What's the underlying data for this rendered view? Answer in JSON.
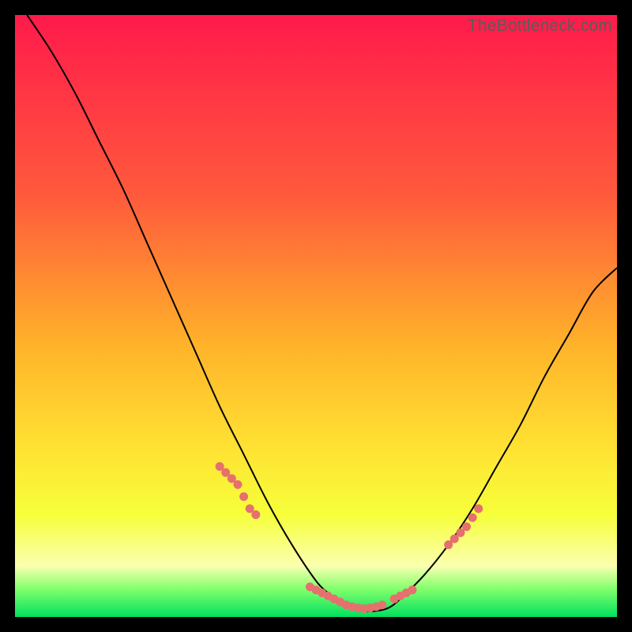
{
  "watermark": "TheBottleneck.com",
  "colors": {
    "grad_top": "#ff1a4b",
    "grad_mid1": "#ff5a3c",
    "grad_mid2": "#ffb329",
    "grad_mid3": "#ffe233",
    "grad_yellowish": "#f6ff3a",
    "grad_pale": "#fbffb0",
    "grad_green1": "#7dff6a",
    "grad_green2": "#00e060",
    "curve": "#000000",
    "dots": "#e6706e"
  },
  "chart_data": {
    "type": "line",
    "title": "",
    "xlabel": "",
    "ylabel": "",
    "xlim": [
      0,
      100
    ],
    "ylim": [
      0,
      100
    ],
    "series": [
      {
        "name": "curve",
        "x": [
          2,
          6,
          10,
          14,
          18,
          22,
          26,
          30,
          34,
          38,
          42,
          46,
          50,
          52,
          54,
          56,
          58,
          60,
          62,
          64,
          68,
          72,
          76,
          80,
          84,
          88,
          92,
          96,
          100
        ],
        "y": [
          100,
          94,
          87,
          79,
          71,
          62,
          53,
          44,
          35,
          27,
          19,
          12,
          6,
          4,
          2.5,
          1.5,
          1,
          1,
          1.5,
          3,
          7,
          12,
          18,
          25,
          32,
          40,
          47,
          54,
          58
        ]
      }
    ],
    "dots": {
      "name": "markers",
      "x": [
        34,
        35,
        36,
        37,
        38,
        39,
        40,
        49,
        50,
        51,
        52,
        53,
        54,
        55,
        56,
        57,
        58,
        59,
        60,
        61,
        63,
        64,
        65,
        66,
        72,
        73,
        74,
        75,
        76,
        77
      ],
      "y": [
        25,
        24,
        23,
        22,
        20,
        18,
        17,
        5,
        4.5,
        4,
        3.5,
        3,
        2.5,
        2,
        1.7,
        1.5,
        1.4,
        1.5,
        1.7,
        2,
        3,
        3.5,
        4,
        4.5,
        12,
        13,
        14,
        15,
        16.5,
        18
      ]
    },
    "gradient_stops": [
      {
        "offset": 0.0,
        "key": "grad_top"
      },
      {
        "offset": 0.3,
        "key": "grad_mid1"
      },
      {
        "offset": 0.55,
        "key": "grad_mid2"
      },
      {
        "offset": 0.72,
        "key": "grad_mid3"
      },
      {
        "offset": 0.83,
        "key": "grad_yellowish"
      },
      {
        "offset": 0.915,
        "key": "grad_pale"
      },
      {
        "offset": 0.955,
        "key": "grad_green1"
      },
      {
        "offset": 1.0,
        "key": "grad_green2"
      }
    ]
  }
}
